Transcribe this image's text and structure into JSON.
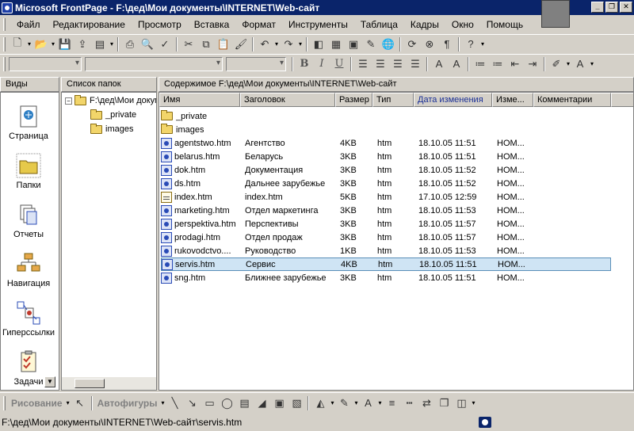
{
  "window": {
    "title": "Microsoft FrontPage - F:\\дед\\Мои документы\\INTERNET\\Web-сайт"
  },
  "menu": [
    "Файл",
    "Редактирование",
    "Просмотр",
    "Вставка",
    "Формат",
    "Инструменты",
    "Таблица",
    "Кадры",
    "Окно",
    "Помощь"
  ],
  "format_toolbar": {
    "bold": "B",
    "italic": "I",
    "underline": "U"
  },
  "panes": {
    "views_header": "Виды",
    "folders_header": "Список папок",
    "contents_header": "Содержимое F:\\дед\\Мои документы\\INTERNET\\Web-сайт"
  },
  "views": [
    "Страница",
    "Папки",
    "Отчеты",
    "Навигация",
    "Гиперссылки",
    "Задачи"
  ],
  "folder_tree": {
    "root": "F:\\дед\\Мои документы\\INTERNET\\Web-сайт",
    "children": [
      "_private",
      "images"
    ]
  },
  "columns": [
    "Имя",
    "Заголовок",
    "Размер",
    "Тип",
    "Дата изменения",
    "Изме...",
    "Комментарии"
  ],
  "folders": [
    "_private",
    "images"
  ],
  "files": [
    {
      "name": "agentstwo.htm",
      "title": "Агентство",
      "size": "4KB",
      "type": "htm",
      "modified": "18.10.05 11:51",
      "by": "HOM..."
    },
    {
      "name": "belarus.htm",
      "title": "Беларусь",
      "size": "3KB",
      "type": "htm",
      "modified": "18.10.05 11:51",
      "by": "HOM..."
    },
    {
      "name": "dok.htm",
      "title": "Документация",
      "size": "3KB",
      "type": "htm",
      "modified": "18.10.05 11:52",
      "by": "HOM..."
    },
    {
      "name": "ds.htm",
      "title": "Дальнее зарубежье",
      "size": "3KB",
      "type": "htm",
      "modified": "18.10.05 11:52",
      "by": "HOM..."
    },
    {
      "name": "index.htm",
      "title": "index.htm",
      "size": "5KB",
      "type": "htm",
      "modified": "17.10.05 12:59",
      "by": "HOM..."
    },
    {
      "name": "marketing.htm",
      "title": "Отдел маркетинга",
      "size": "3KB",
      "type": "htm",
      "modified": "18.10.05 11:53",
      "by": "HOM..."
    },
    {
      "name": "perspektiva.htm",
      "title": "Перспективы",
      "size": "3KB",
      "type": "htm",
      "modified": "18.10.05 11:57",
      "by": "HOM..."
    },
    {
      "name": "prodagi.htm",
      "title": "Отдел продаж",
      "size": "3KB",
      "type": "htm",
      "modified": "18.10.05 11:57",
      "by": "HOM..."
    },
    {
      "name": "rukovodctvo....",
      "title": "Руководство",
      "size": "1KB",
      "type": "htm",
      "modified": "18.10.05 11:53",
      "by": "HOM..."
    },
    {
      "name": "servis.htm",
      "title": "Сервис",
      "size": "4KB",
      "type": "htm",
      "modified": "18.10.05 11:51",
      "by": "HOM..."
    },
    {
      "name": "sng.htm",
      "title": "Ближнее зарубежье",
      "size": "3KB",
      "type": "htm",
      "modified": "18.10.05 11:51",
      "by": "HOM..."
    }
  ],
  "selected_file": "servis.htm",
  "drawing_toolbar": {
    "draw_label": "Рисование",
    "autoshapes_label": "Автофигуры"
  },
  "status": {
    "path": "F:\\дед\\Мои документы\\INTERNET\\Web-сайт\\servis.htm"
  }
}
